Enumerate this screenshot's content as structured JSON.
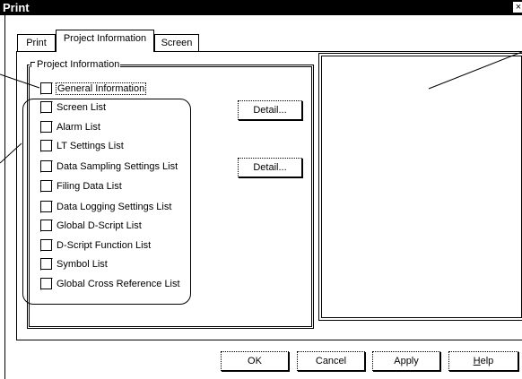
{
  "window": {
    "title": "Print",
    "close_glyph": "×"
  },
  "tabs": [
    {
      "label": "Print",
      "active": false
    },
    {
      "label": "Project Information",
      "active": true
    },
    {
      "label": "Screen",
      "active": false
    }
  ],
  "group": {
    "title": "Project Information"
  },
  "items": [
    {
      "label": "General Information",
      "checked": false
    },
    {
      "label": "Screen List",
      "checked": false
    },
    {
      "label": "Alarm List",
      "checked": false
    },
    {
      "label": "LT Settings List",
      "checked": false
    },
    {
      "label": "Data Sampling Settings List",
      "checked": false
    },
    {
      "label": "Filing Data List",
      "checked": false
    },
    {
      "label": "Data Logging Settings List",
      "checked": false
    },
    {
      "label": "Global D-Script List",
      "checked": false
    },
    {
      "label": "D-Script Function List",
      "checked": false
    },
    {
      "label": "Symbol List",
      "checked": false
    },
    {
      "label": "Global Cross Reference List",
      "checked": false
    }
  ],
  "detail_buttons": [
    {
      "label": "Detail..."
    },
    {
      "label": "Detail..."
    }
  ],
  "footer": {
    "ok": "OK",
    "cancel": "Cancel",
    "apply": "Apply",
    "help_mnemonic": "H",
    "help_rest": "elp"
  },
  "icons": {
    "checkbox": "checkbox-icon",
    "close": "close-icon",
    "legend_corner": "corner-icon"
  }
}
